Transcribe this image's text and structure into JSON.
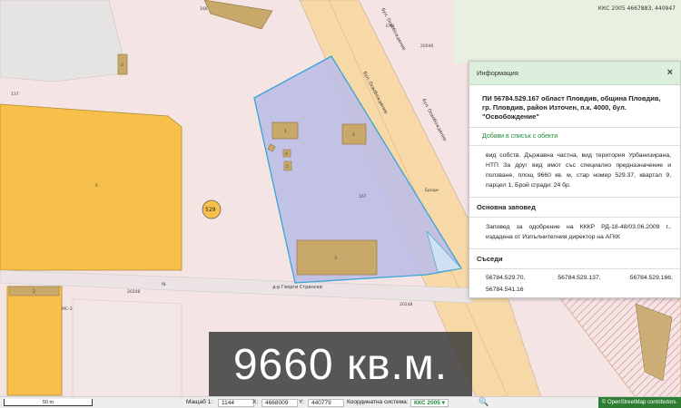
{
  "map": {
    "top_right_coords": "ККС 2005 4667883, 440947",
    "streets": {
      "boulevard_a": "бул. Освобождение",
      "boulevard_b": "бул. Освобождение",
      "boulevard_c": "бул. Освобождение",
      "bottom_street": "д-р Георги Странски"
    },
    "parcel_numbers": {
      "main": "167",
      "left_block": "6",
      "block_id": "529",
      "small_building_1": "1",
      "small_building_2": "2",
      "small_building_3": "3",
      "small_building_4": "4",
      "small_building_5": "5",
      "top_label": "166",
      "left_label": "137",
      "road_label": "20248",
      "road_label_2": "20248",
      "road_label_3": "20046",
      "lower_left": "МС-3ри",
      "ubc_label": "Бреди",
      "sub_label": "ЕЛК",
      "bottom_left_bldg": "2",
      "top_left_bldg": "2",
      "f8_label": "f8"
    }
  },
  "info_panel": {
    "title": "Информация",
    "close_label": "×",
    "parcel_heading": "ПИ 56784.529.167 област Пловдив, община Пловдив, гр. Пловдив, район Източен, п.к. 4000, бул. \"Освобождение\"",
    "add_link": "Добави в списък с обекти",
    "description": "вид собств. Държавна частна, вид територия Урбанизирана, НТП За друг вид имот със специално предназначение и ползване, площ 9660 кв. м, стар номер 529.37, квартал 9, парцел 1, Брой сгради: 24 бр.",
    "order_title": "Основна заповед",
    "order_text": "Заповед за одобрение на КККР РД-18-48/03.06.2009 г., издадена от Изпълнителния директор на АГКК",
    "neighbors_title": "Съседи",
    "neighbors": [
      "56784.529.70,",
      "56784.529.137,",
      "56784.529.166,",
      "56784.541.16",
      "",
      ""
    ]
  },
  "overlay": {
    "area_text": "9660 кв.м."
  },
  "bottom_bar": {
    "scale_label": "50 m",
    "scale_prefix": "Мащаб 1:",
    "scale_value": "1144",
    "x_label": "X:",
    "x_value": "4668009",
    "y_label": "Y:",
    "y_value": "440779",
    "crs_label": "Координатна система:",
    "crs_value": "ККС 2005 ▾",
    "search_icon": "🔍",
    "credit": "© OpenStreetMap contributors."
  },
  "colors": {
    "parcel_fill": "#bcbce6",
    "parcel_stroke": "#3aa4d6",
    "building": "#c8a96a",
    "yellow_block": "#f7c04a",
    "road": "#f7d9a8",
    "accent_green": "#1f8a3c"
  }
}
